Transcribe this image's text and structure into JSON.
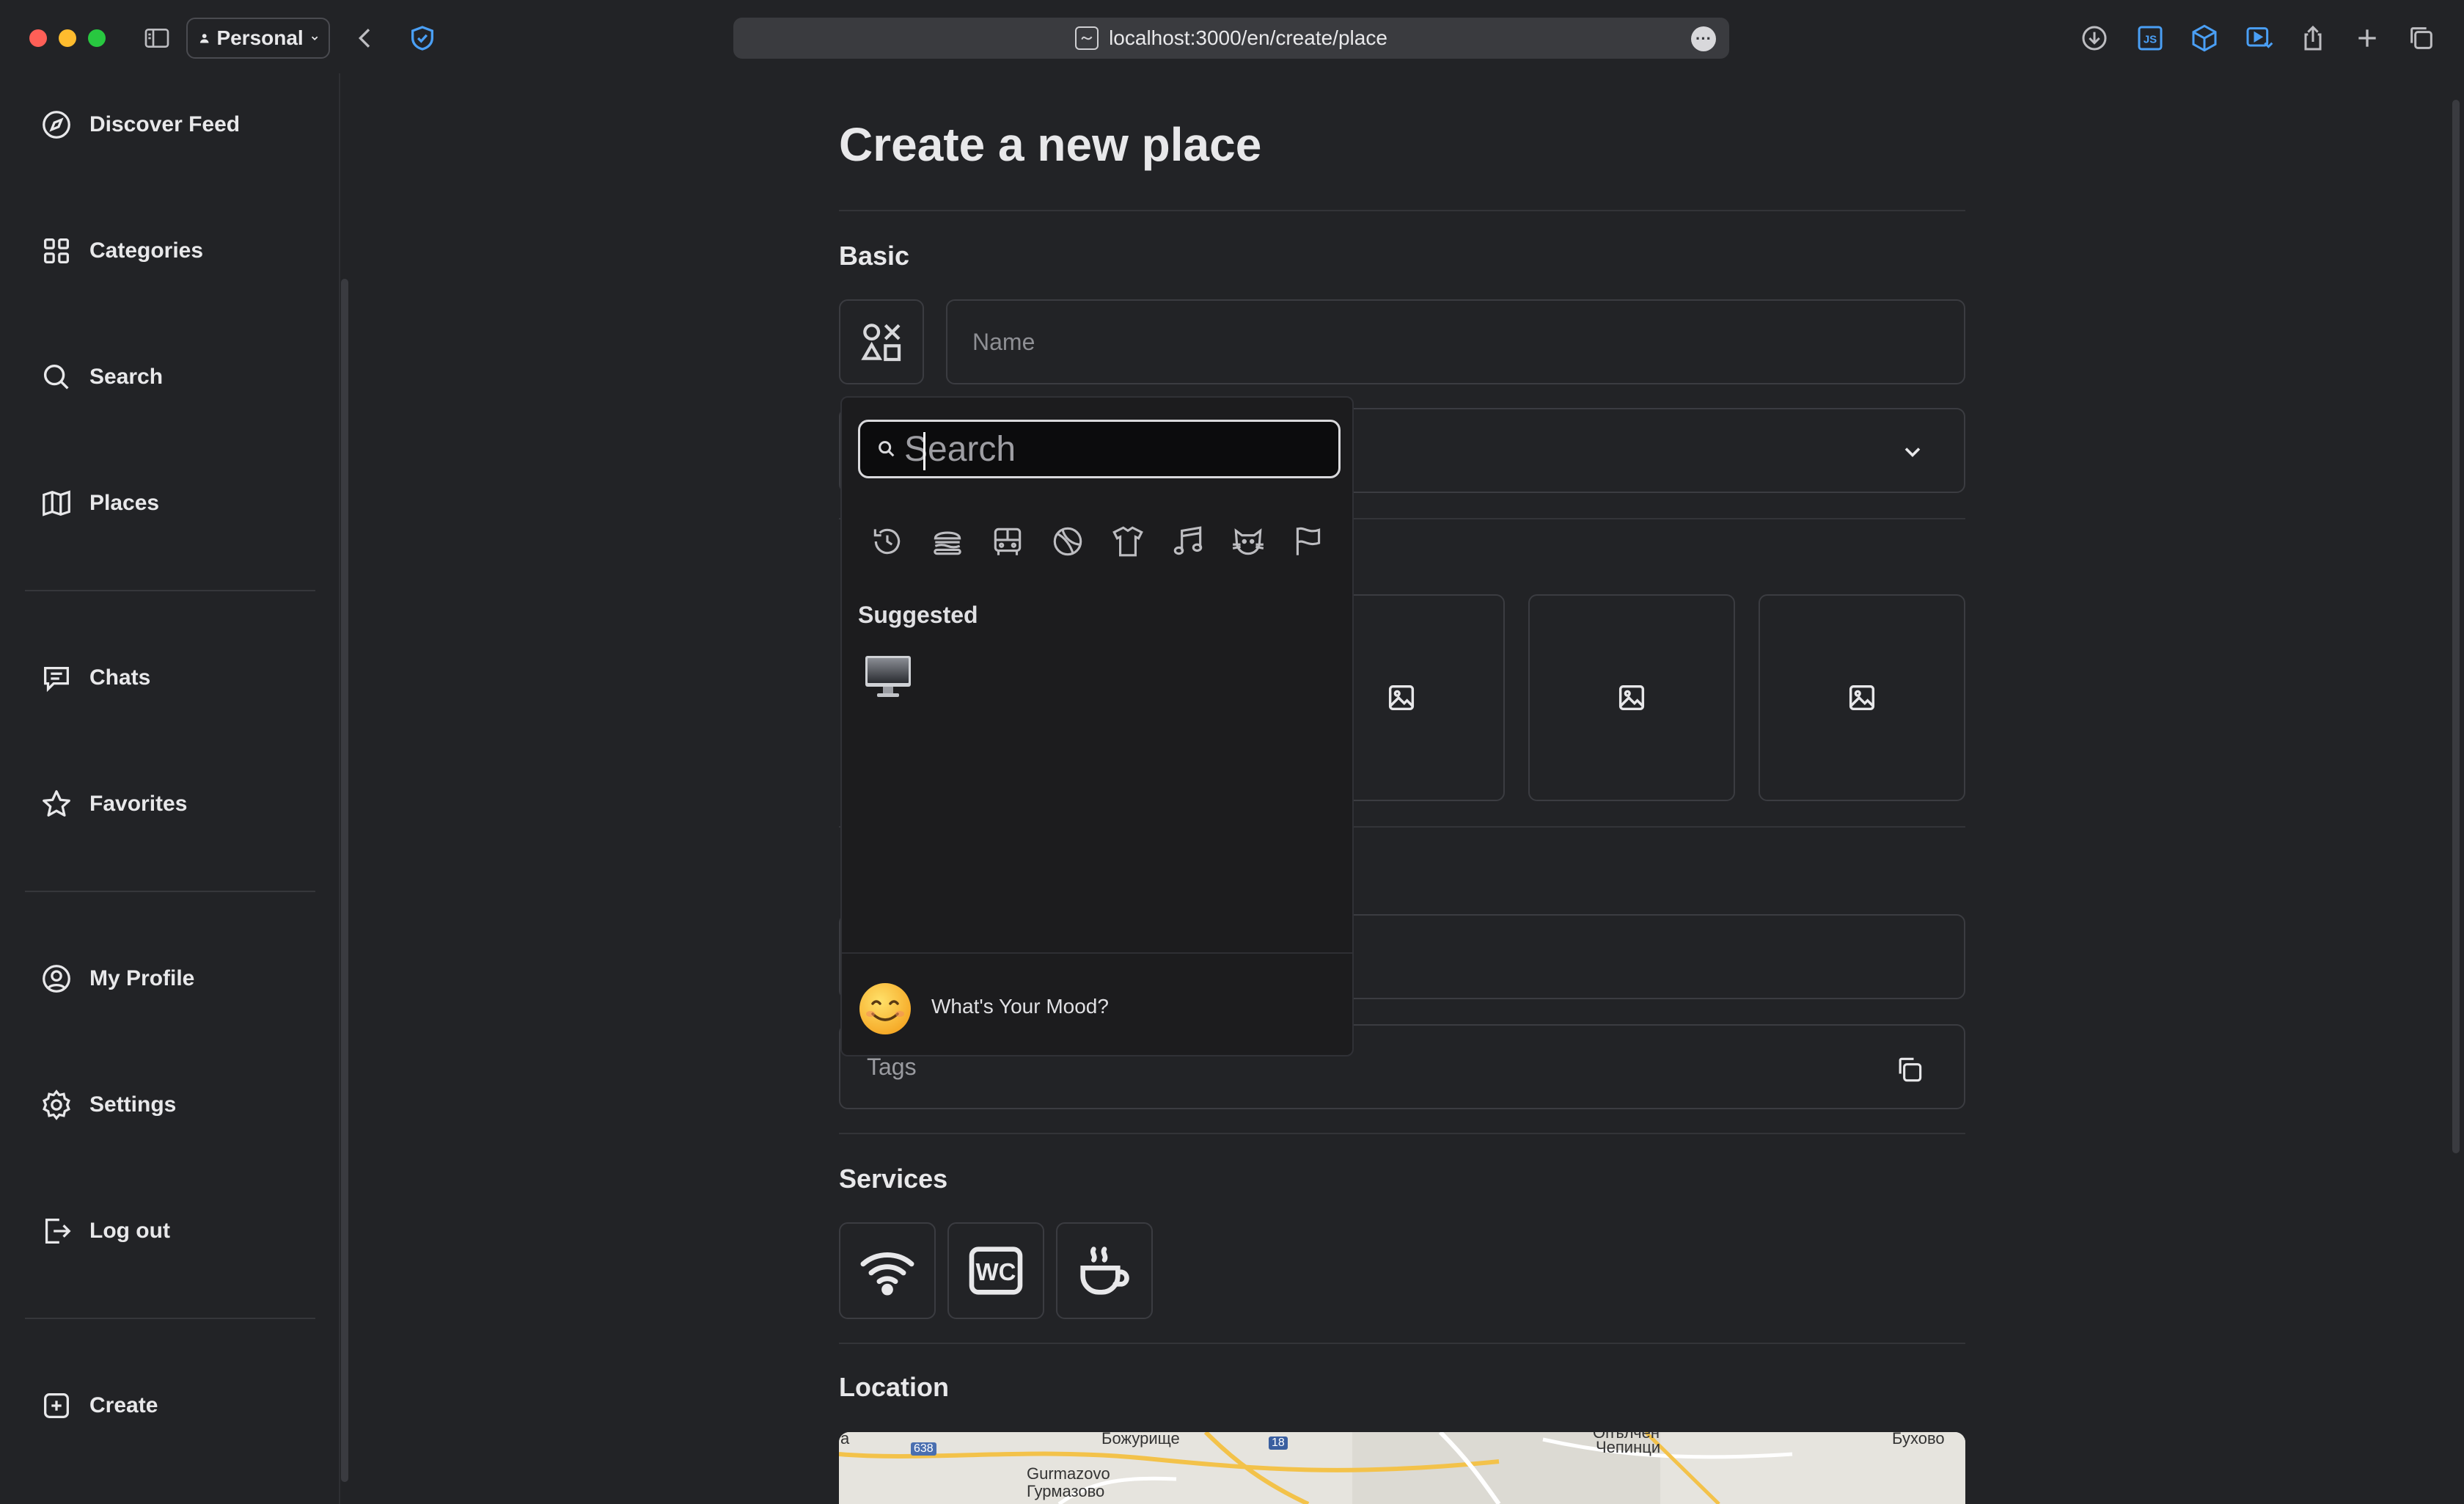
{
  "browser": {
    "profile_label": "Personal",
    "url": "localhost:3000/en/create/place",
    "url_more": "···"
  },
  "sidebar": {
    "items": [
      {
        "label": "Discover Feed",
        "icon": "compass-icon"
      },
      {
        "label": "Categories",
        "icon": "grid-icon"
      },
      {
        "label": "Search",
        "icon": "search-icon"
      },
      {
        "label": "Places",
        "icon": "map-icon"
      },
      {
        "label": "Chats",
        "icon": "chat-icon"
      },
      {
        "label": "Favorites",
        "icon": "star-icon"
      },
      {
        "label": "My Profile",
        "icon": "user-circle-icon"
      },
      {
        "label": "Settings",
        "icon": "gear-icon"
      },
      {
        "label": "Log out",
        "icon": "logout-icon"
      },
      {
        "label": "Create",
        "icon": "plus-square-icon"
      }
    ]
  },
  "main": {
    "page_title": "Create a new place",
    "sections": {
      "basic": "Basic",
      "services": "Services",
      "location": "Location"
    },
    "name_placeholder": "Name",
    "tags_placeholder": "Tags",
    "services": [
      {
        "name": "wifi",
        "icon": "wifi-icon"
      },
      {
        "name": "wc",
        "icon": "wc-icon"
      },
      {
        "name": "coffee",
        "icon": "coffee-icon"
      }
    ],
    "map_labels": [
      {
        "text": "а"
      },
      {
        "text": "Божурище"
      },
      {
        "text": "638"
      },
      {
        "text": "18"
      },
      {
        "text": "Gurmazovo"
      },
      {
        "text": "Гурмазово"
      },
      {
        "text": "Опълчен"
      },
      {
        "text": "Чепинци"
      },
      {
        "text": "Бухово"
      }
    ]
  },
  "emoji_picker": {
    "search_placeholder": "Search",
    "categories": [
      "recent-icon",
      "food-icon",
      "travel-icon",
      "activity-icon",
      "objects-icon",
      "symbols-icon",
      "animals-icon",
      "flags-icon"
    ],
    "suggested_heading": "Suggested",
    "suggested": [
      "desktop-computer-emoji"
    ],
    "footer_text": "What's Your Mood?"
  },
  "colors": {
    "background": "#222326",
    "text": "#e8e8ea",
    "border": "#3b3c41",
    "popover": "#1c1c1e",
    "accent_blue": "#4a9ff5"
  }
}
